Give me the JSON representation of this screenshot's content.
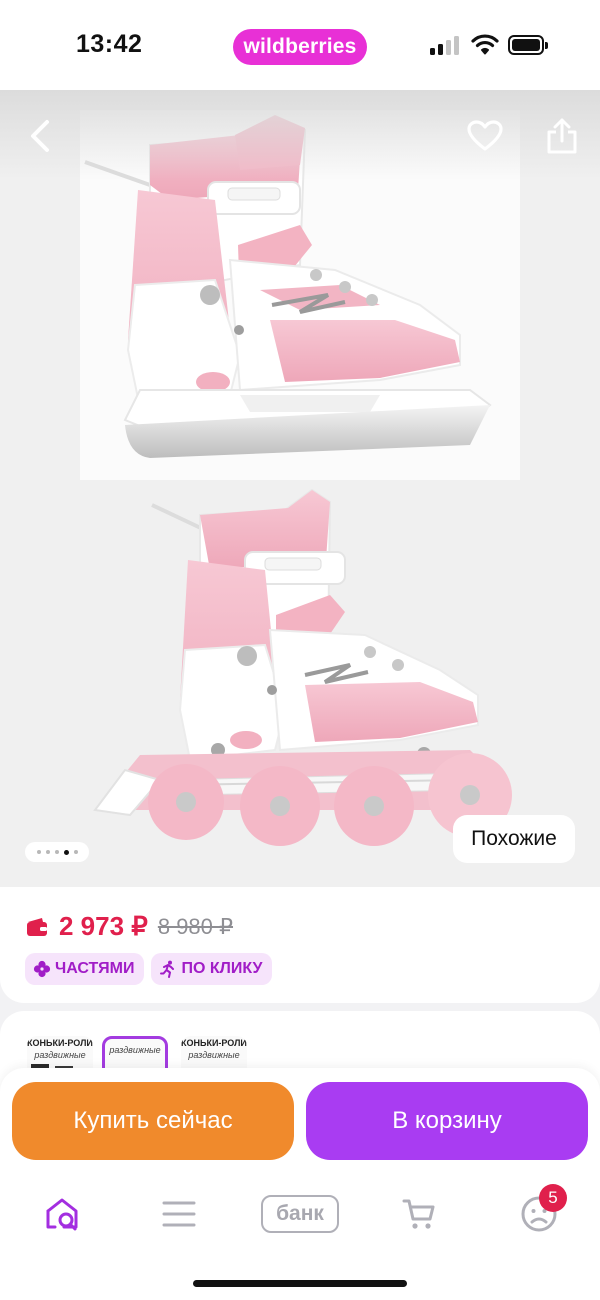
{
  "status_bar": {
    "time": "13:42",
    "brand": "wildberries",
    "icons": [
      "cellular-signal-icon",
      "wifi-icon",
      "battery-icon"
    ]
  },
  "gallery": {
    "similar_label": "Похожие",
    "image_count": 5,
    "active_image_index": 3,
    "icons": [
      "back-arrow-icon",
      "heart-icon",
      "share-icon"
    ]
  },
  "price": {
    "current": "2 973 ₽",
    "old": "8 980 ₽",
    "accent_color": "#e0204c",
    "tags": [
      {
        "icon": "clover-icon",
        "label": "ЧАСТЯМИ"
      },
      {
        "icon": "running-person-icon",
        "label": "ПО КЛИКУ"
      }
    ]
  },
  "variants": {
    "thumbs": [
      {
        "title": "КОНЬКИ-РОЛИКИ",
        "sub": "раздвижные",
        "selected": false
      },
      {
        "title": "",
        "sub": "раздвижные",
        "selected": true
      },
      {
        "title": "КОНЬКИ-РОЛИКИ",
        "sub": "раздвижные",
        "selected": false
      }
    ]
  },
  "actions": {
    "buy_now": "Купить сейчас",
    "add_to_cart": "В корзину",
    "buy_now_color": "#f08a2c",
    "add_to_cart_color": "#a93cf2"
  },
  "tabbar": {
    "items": [
      {
        "icon": "home-search-icon",
        "active": true
      },
      {
        "icon": "menu-icon",
        "active": false
      },
      {
        "icon": "bank-icon",
        "label": "банк",
        "active": false
      },
      {
        "icon": "cart-icon",
        "active": false
      },
      {
        "icon": "profile-icon",
        "active": false,
        "badge": "5"
      }
    ]
  }
}
